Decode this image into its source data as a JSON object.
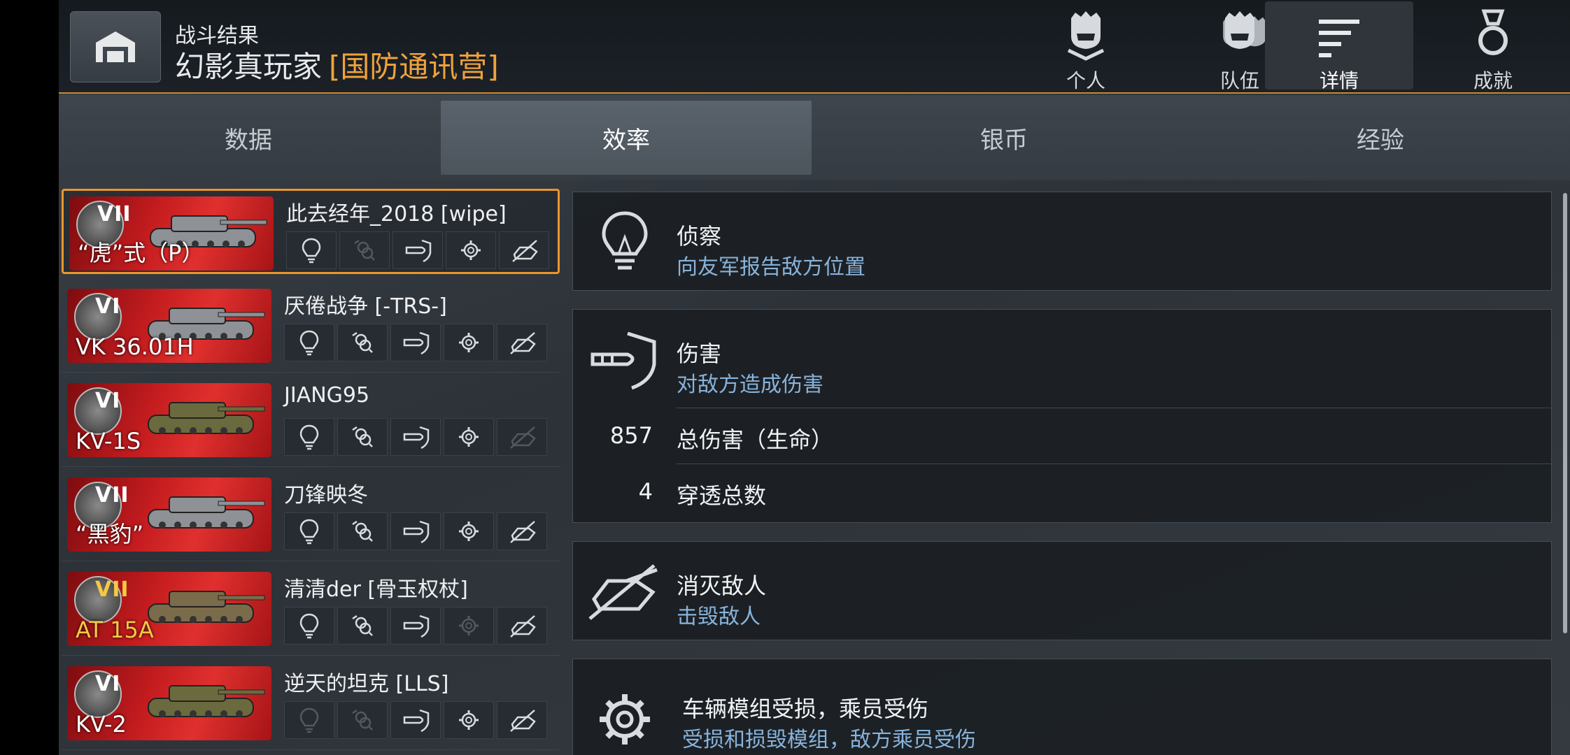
{
  "header": {
    "label": "战斗结果",
    "player": "幻影真玩家",
    "clan": "[国防通讯营]",
    "nav": [
      {
        "label": "个人",
        "icon": "personal-helmet-icon"
      },
      {
        "label": "队伍",
        "icon": "team-helmets-icon"
      },
      {
        "label": "详情",
        "icon": "details-list-icon",
        "active": true
      },
      {
        "label": "成就",
        "icon": "medal-icon"
      }
    ]
  },
  "tabs": [
    {
      "label": "数据"
    },
    {
      "label": "效率",
      "active": true
    },
    {
      "label": "银币"
    },
    {
      "label": "经验"
    }
  ],
  "players": [
    {
      "tier": "VII",
      "tank": "“虎”式（P）",
      "name": "此去经年_2018 [wipe]",
      "nation": "germany",
      "badges": [
        true,
        false,
        true,
        true,
        true
      ],
      "selected": true
    },
    {
      "tier": "VI",
      "tank": "VK 36.01H",
      "name": "厌倦战争 [-TRS-]",
      "nation": "germany",
      "badges": [
        true,
        true,
        true,
        true,
        true
      ]
    },
    {
      "tier": "VI",
      "tank": "KV-1S",
      "name": "JIANG95",
      "nation": "ussr",
      "badges": [
        true,
        true,
        true,
        true,
        false
      ]
    },
    {
      "tier": "VII",
      "tank": "“黑豹”",
      "name": "刀锋映冬",
      "nation": "germany",
      "badges": [
        true,
        true,
        true,
        true,
        true
      ]
    },
    {
      "tier": "VII",
      "tank": "AT 15A",
      "name": "清清der [骨玉权杖]",
      "nation": "uk",
      "premium": true,
      "badges": [
        true,
        true,
        true,
        false,
        true
      ]
    },
    {
      "tier": "VI",
      "tank": "KV-2",
      "name": "逆天的坦克 [LLS]",
      "nation": "ussr",
      "badges": [
        false,
        false,
        true,
        true,
        true
      ]
    }
  ],
  "sections": {
    "spotting": {
      "title": "侦察",
      "subtitle": "向友军报告敌方位置"
    },
    "damage": {
      "title": "伤害",
      "subtitle": "对敌方造成伤害",
      "stats": [
        {
          "value": "857",
          "label": "总伤害（生命）"
        },
        {
          "value": "4",
          "label": "穿透总数"
        }
      ]
    },
    "kills": {
      "title": "消灭敌人",
      "subtitle": "击毁敌人"
    },
    "modules": {
      "title": "车辆模组受损，乘员受伤",
      "subtitle": "受损和损毁模组，敌方乘员受伤"
    }
  },
  "colors": {
    "accent": "#e9962b",
    "clan": "#f0a23c",
    "subtitle": "#88b3db"
  }
}
